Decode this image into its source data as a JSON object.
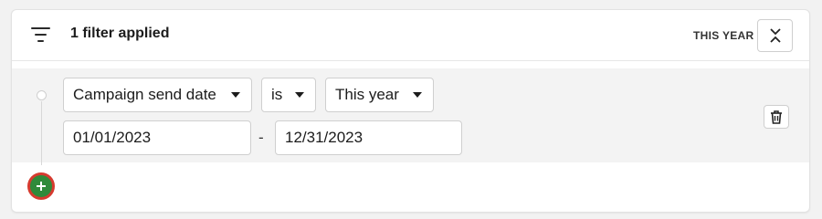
{
  "header": {
    "title": "1 filter applied",
    "period_label": "THIS YEAR"
  },
  "filter": {
    "field": "Campaign send date",
    "operator": "is",
    "value": "This year",
    "start_date": "01/01/2023",
    "end_date": "12/31/2023",
    "range_separator": "-"
  },
  "icons": {
    "filter": "filter-lines-icon",
    "collapse": "collapse-icon",
    "delete": "trash-icon",
    "add": "plus-icon"
  },
  "colors": {
    "add_button": "#2f8a3a",
    "add_button_ring": "#d63a2f"
  }
}
